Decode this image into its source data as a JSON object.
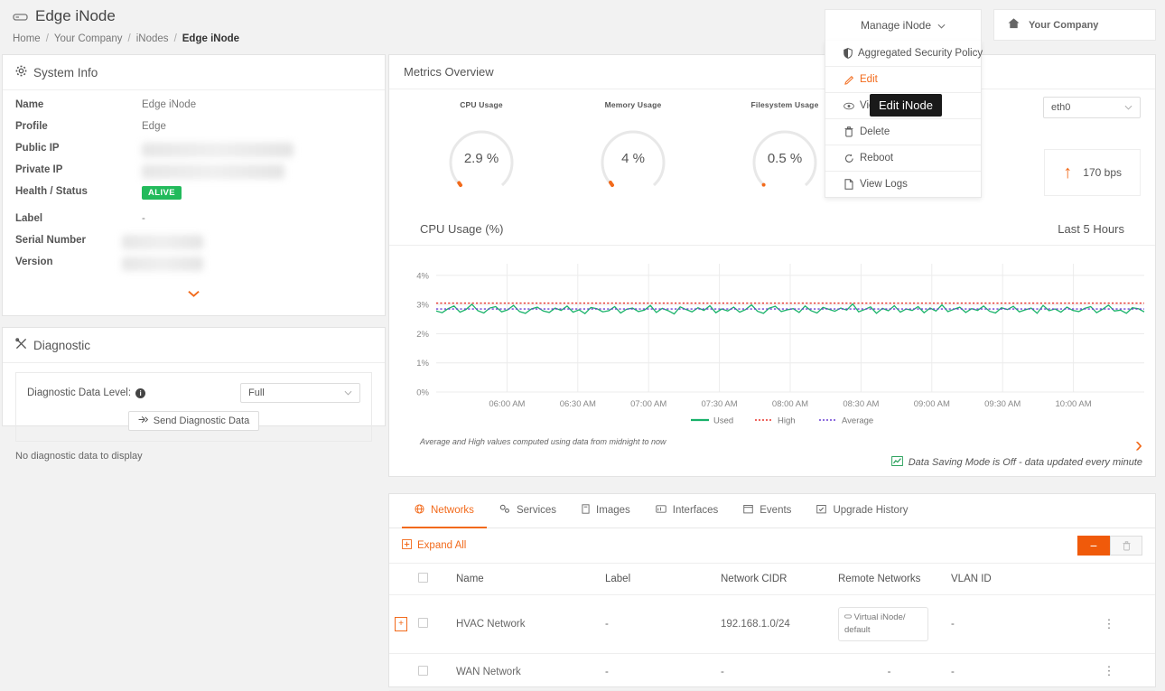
{
  "header": {
    "title": "Edge iNode",
    "title_icon": "server-icon",
    "breadcrumb": [
      "Home",
      "Your Company",
      "iNodes",
      "Edge iNode"
    ],
    "company_label": "Your Company",
    "company_icon": "home-icon"
  },
  "manage_menu": {
    "trigger_label": "Manage iNode",
    "tooltip": "Edit iNode",
    "items": [
      {
        "label": "Aggregated Security Policy",
        "icon": "shield-icon",
        "highlighted": false
      },
      {
        "label": "Edit",
        "icon": "pencil-icon",
        "highlighted": true
      },
      {
        "label": "View",
        "icon": "eye-icon",
        "highlighted": false
      },
      {
        "label": "Delete",
        "icon": "trash-icon",
        "highlighted": false
      },
      {
        "label": "Reboot",
        "icon": "refresh-icon",
        "highlighted": false
      },
      {
        "label": "View Logs",
        "icon": "document-icon",
        "highlighted": false
      }
    ]
  },
  "system_info": {
    "title": "System Info",
    "title_icon": "gear-icon",
    "rows": [
      {
        "key": "Name",
        "value": "Edge iNode",
        "redacted": false
      },
      {
        "key": "Profile",
        "value": "Edge",
        "redacted": false
      },
      {
        "key": "Public IP",
        "value": "",
        "redacted": true
      },
      {
        "key": "Private IP",
        "value": "",
        "redacted": true
      },
      {
        "key": "Health / Status",
        "value": "ALIVE",
        "redacted": false,
        "badge": true
      },
      {
        "key": "Label",
        "value": "-",
        "redacted": false
      },
      {
        "key": "Serial Number",
        "value": "",
        "redacted": true
      },
      {
        "key": "Version",
        "value": "",
        "redacted": true
      }
    ],
    "expand_icon": "chevron-down-icon"
  },
  "diagnostic": {
    "title": "Diagnostic",
    "title_icon": "tools-icon",
    "level_label": "Diagnostic Data Level:",
    "level_value": "Full",
    "send_button": "Send Diagnostic Data",
    "send_icon": "send-icon",
    "empty_text": "No diagnostic data to display"
  },
  "metrics": {
    "title": "Metrics Overview",
    "gauges": [
      {
        "label": "CPU Usage",
        "value": "2.9 %",
        "pct": 2.9
      },
      {
        "label": "Memory Usage",
        "value": "4 %",
        "pct": 4
      },
      {
        "label": "Filesystem Usage",
        "value": "0.5 %",
        "pct": 0.5
      }
    ],
    "interface_select": "eth0",
    "traffic": {
      "value": "170 bps",
      "direction_icon": "arrow-up-icon"
    },
    "next_icon": "chevron-right-icon",
    "saving_mode_text": "Data Saving Mode is Off - data updated every minute",
    "saving_mode_icon": "chart-icon"
  },
  "chart_data": {
    "type": "line",
    "title": "CPU Usage (%)",
    "range_label": "Last 5 Hours",
    "note": "Average and High values computed using data from midnight to now",
    "xlabel": "",
    "ylabel": "",
    "ylim": [
      0,
      4.4
    ],
    "yticks": [
      0,
      1,
      2,
      3,
      4
    ],
    "ytick_labels": [
      "0%",
      "1%",
      "2%",
      "3%",
      "4%"
    ],
    "grid": true,
    "legend_position": "bottom",
    "x_tick_labels": [
      "06:00 AM",
      "06:30 AM",
      "07:00 AM",
      "07:30 AM",
      "08:00 AM",
      "08:30 AM",
      "09:00 AM",
      "09:30 AM",
      "10:00 AM"
    ],
    "series": [
      {
        "name": "Used",
        "color": "#17b169",
        "style": "solid",
        "values": [
          2.78,
          2.72,
          2.86,
          2.95,
          2.74,
          2.83,
          3.01,
          2.79,
          2.71,
          2.88,
          2.93,
          2.75,
          2.82,
          2.97,
          2.76,
          2.7,
          2.85,
          2.91,
          2.78,
          2.73,
          2.88,
          2.8,
          2.95,
          2.74,
          2.82,
          2.69,
          2.9,
          2.86,
          2.75,
          2.79,
          2.93,
          2.71,
          2.84,
          2.88,
          2.76,
          2.81,
          2.97,
          2.73,
          2.87,
          2.79,
          2.68,
          2.92,
          2.83,
          2.75,
          2.89,
          2.8,
          2.96,
          2.72,
          2.85,
          2.78,
          2.91,
          2.74,
          2.83,
          2.99,
          2.77,
          2.7,
          2.88,
          2.94,
          2.76,
          2.82,
          2.86,
          2.73,
          2.95,
          2.79,
          2.71,
          2.9,
          2.84,
          2.77,
          2.88,
          2.81,
          3.02,
          2.75,
          2.83,
          2.92,
          2.7,
          2.87,
          2.79,
          2.96,
          2.74,
          2.85,
          2.8,
          2.93,
          2.72,
          2.88,
          2.78,
          2.99,
          2.76,
          2.84,
          2.91,
          2.73,
          2.86,
          2.8,
          2.95,
          2.77,
          2.71,
          2.89,
          2.83,
          2.94,
          2.75,
          2.82,
          2.88,
          2.7,
          2.97,
          2.79,
          2.85,
          2.74,
          2.91,
          2.8,
          2.76,
          2.87,
          2.93,
          2.72,
          2.84,
          2.98,
          2.78,
          2.81,
          2.7,
          2.89,
          2.86,
          2.75
        ]
      },
      {
        "name": "High",
        "color": "#e8322a",
        "style": "dotted",
        "constant": 3.05
      },
      {
        "name": "Average",
        "color": "#6a3fd4",
        "style": "dotted",
        "constant": 2.85
      }
    ]
  },
  "bottom_tabs": {
    "tabs": [
      {
        "label": "Networks",
        "icon": "network-icon",
        "active": true
      },
      {
        "label": "Services",
        "icon": "services-icon",
        "active": false
      },
      {
        "label": "Images",
        "icon": "image-icon",
        "active": false
      },
      {
        "label": "Interfaces",
        "icon": "interface-icon",
        "active": false
      },
      {
        "label": "Events",
        "icon": "events-icon",
        "active": false
      },
      {
        "label": "Upgrade History",
        "icon": "upgrade-icon",
        "active": false
      }
    ],
    "expand_all": "Expand All",
    "expand_all_icon": "plus-square-icon",
    "collapse_button_icon": "minus-icon",
    "delete_button_icon": "trash-icon",
    "table": {
      "columns": [
        "Name",
        "Label",
        "Network CIDR",
        "Remote Networks",
        "VLAN ID"
      ],
      "rows": [
        {
          "expandable": true,
          "name": "HVAC Network",
          "label": "-",
          "cidr": "192.168.1.0/24",
          "remote_networks": "Virtual iNode/ default",
          "remote_chip": true,
          "vlan_id": "-"
        },
        {
          "expandable": false,
          "name": "WAN Network",
          "label": "-",
          "cidr": "-",
          "remote_networks": "-",
          "remote_chip": false,
          "vlan_id": "-"
        }
      ]
    }
  },
  "colors": {
    "accent": "#f26a1b",
    "accent_strong": "#f05a0a",
    "alive_green": "#22ba5b",
    "used_line": "#17b169",
    "high_line": "#e8322a",
    "average_line": "#6a3fd4"
  }
}
